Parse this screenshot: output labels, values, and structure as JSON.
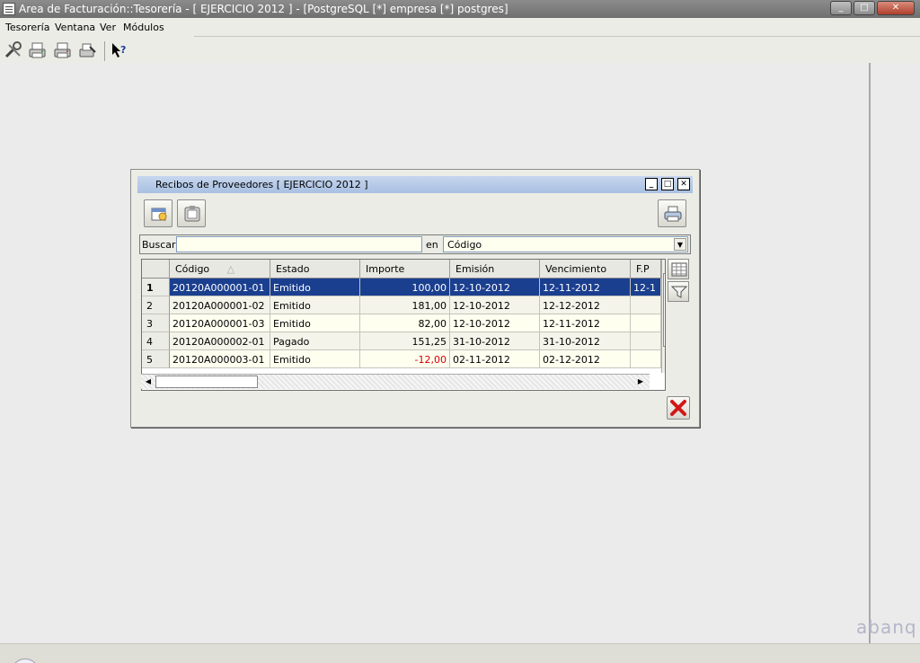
{
  "window": {
    "title": "Area de Facturación::Tesorería  - [ EJERCICIO 2012 ] - [PostgreSQL [*] empresa [*] postgres]",
    "buttons": {
      "minimize": "_",
      "maximize": "□",
      "close": "✕"
    }
  },
  "menu": {
    "items": [
      {
        "label": "Tesorería"
      },
      {
        "label": "Ventana"
      },
      {
        "label": "Ver"
      },
      {
        "label": "Módulos"
      }
    ]
  },
  "toolbar": {
    "icons": [
      "tools-icon",
      "print-icon",
      "print-preview-icon",
      "print-options-icon",
      "whats-this-help-icon"
    ]
  },
  "child_window": {
    "title": "Recibos de Proveedores [ EJERCICIO 2012 ]",
    "buttons": {
      "minimize": "_",
      "maximize": "□",
      "close": "✕"
    }
  },
  "search": {
    "label": "Buscar",
    "value": "",
    "en_label": "en",
    "field_selected": "Código"
  },
  "table": {
    "columns": [
      "Código",
      "Estado",
      "Importe",
      "Emisión",
      "Vencimiento",
      "F.P"
    ],
    "sort_column": "Código",
    "selected_row": 1,
    "rows": [
      {
        "n": "1",
        "codigo": "20120A000001-01",
        "estado": "Emitido",
        "importe": "100,00",
        "emision": "12-10-2012",
        "vencimiento": "12-11-2012",
        "fp": "12-1"
      },
      {
        "n": "2",
        "codigo": "20120A000001-02",
        "estado": "Emitido",
        "importe": "181,00",
        "emision": "12-10-2012",
        "vencimiento": "12-12-2012",
        "fp": ""
      },
      {
        "n": "3",
        "codigo": "20120A000001-03",
        "estado": "Emitido",
        "importe": "82,00",
        "emision": "12-10-2012",
        "vencimiento": "12-11-2012",
        "fp": ""
      },
      {
        "n": "4",
        "codigo": "20120A000002-01",
        "estado": "Pagado",
        "importe": "151,25",
        "emision": "31-10-2012",
        "vencimiento": "31-10-2012",
        "fp": ""
      },
      {
        "n": "5",
        "codigo": "20120A000003-01",
        "estado": "Emitido",
        "importe": "-12,00",
        "emision": "02-11-2012",
        "vencimiento": "02-12-2012",
        "fp": ""
      }
    ]
  },
  "watermark": "abanq"
}
